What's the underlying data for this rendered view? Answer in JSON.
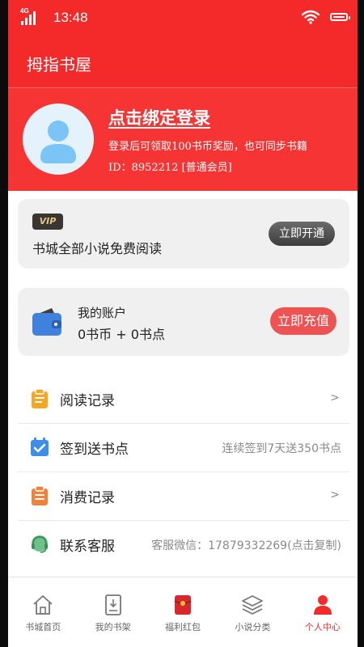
{
  "status_bar": {
    "network": "4G",
    "time": "13:48"
  },
  "header": {
    "title": "拇指书屋"
  },
  "profile": {
    "login_prompt": "点击绑定登录",
    "login_desc": "登录后可领取100书币奖励，也可同步书籍",
    "user_id": "ID：8952212 [普通会员]"
  },
  "vip_card": {
    "badge": "VIP",
    "description": "书城全部小说免费阅读",
    "button": "立即开通"
  },
  "account_card": {
    "label": "我的账户",
    "balance": "0书币 + 0书点",
    "button": "立即充值"
  },
  "menu": [
    {
      "label": "阅读记录",
      "icon": "clipboard-icon",
      "right": ">"
    },
    {
      "label": "签到送书点",
      "icon": "calendar-check-icon",
      "right": "连续签到7天送350书点"
    },
    {
      "label": "消费记录",
      "icon": "receipt-icon",
      "right": ">"
    },
    {
      "label": "联系客服",
      "icon": "headset-icon",
      "right": "客服微信：17879332269(点击复制)"
    }
  ],
  "tabs": [
    {
      "label": "书城首页",
      "icon": "home-icon",
      "active": false
    },
    {
      "label": "我的书架",
      "icon": "bookshelf-icon",
      "active": false
    },
    {
      "label": "福利红包",
      "icon": "red-envelope-icon",
      "active": false
    },
    {
      "label": "小说分类",
      "icon": "layers-icon",
      "active": false
    },
    {
      "label": "个人中心",
      "icon": "user-icon",
      "active": true
    }
  ],
  "colors": {
    "brand_red": "#f42a2a",
    "header_red": "#f73434",
    "recharge_red": "#ee5252",
    "card_gray": "#f0f0f0"
  }
}
